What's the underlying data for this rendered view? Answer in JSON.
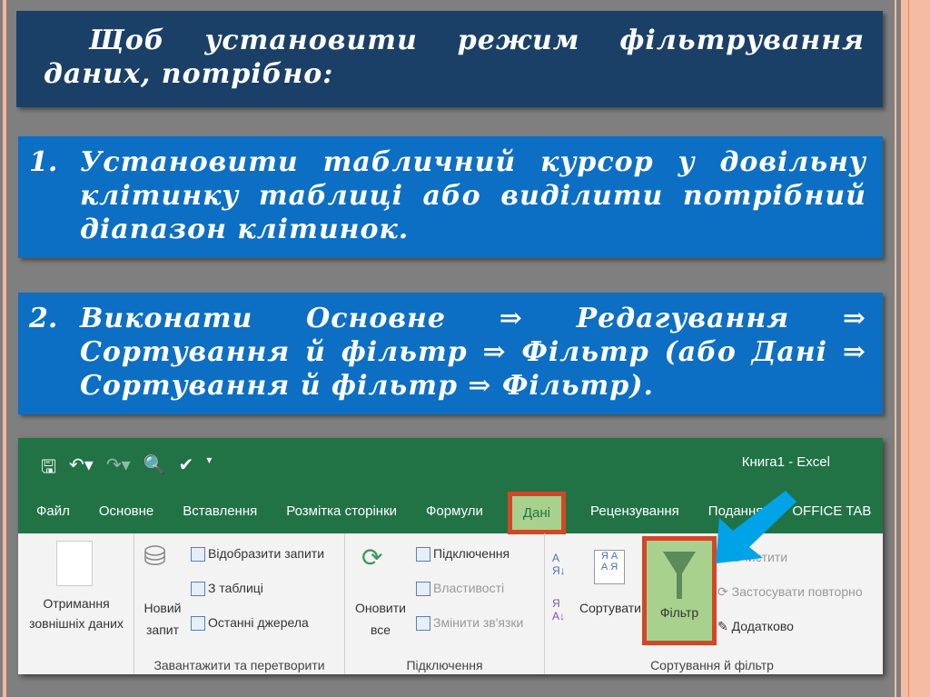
{
  "slide": {
    "title": "Щоб установити режим фільтрування даних, потрібно:",
    "steps": [
      {
        "num": "1.",
        "text": "Установити табличний курсор у довільну клітинку таблиці або виділити потрібний діапазон клітинок."
      },
      {
        "num": "2.",
        "text": "Виконати Основне ⇒ Редагування ⇒ Сортування й фільтр ⇒ Фільтр (або Дані ⇒ Сортування й фільтр ⇒ Фільтр)."
      }
    ]
  },
  "excel": {
    "window_title": "Книга1 - Excel",
    "tabs": [
      "Файл",
      "Основне",
      "Вставлення",
      "Розмітка сторінки",
      "Формули",
      "Дані",
      "Рецензування",
      "Подання",
      "OFFICE TAB"
    ],
    "groups": {
      "get": {
        "btn": "Отримання зовнішніх даних",
        "new_query": "Новий запит",
        "show": "Відобразити запити",
        "from_table": "З таблиці",
        "recent": "Останні джерела",
        "label": "Завантажити та перетворити"
      },
      "conn": {
        "refresh": "Оновити все",
        "connections": "Підключення",
        "properties": "Властивості",
        "edit_links": "Змінити зв'язки",
        "label": "Підключення"
      },
      "sort": {
        "sort": "Сортувати",
        "filter": "Фільтр",
        "clear": "Очистити",
        "reapply": "Застосувати повторно",
        "advanced": "Додатково",
        "label": "Сортування й фільтр"
      }
    },
    "colors": {
      "green": "#217346",
      "highlight": "#a9d18e",
      "outline": "#d24726",
      "arrow": "#00a2e8"
    }
  }
}
